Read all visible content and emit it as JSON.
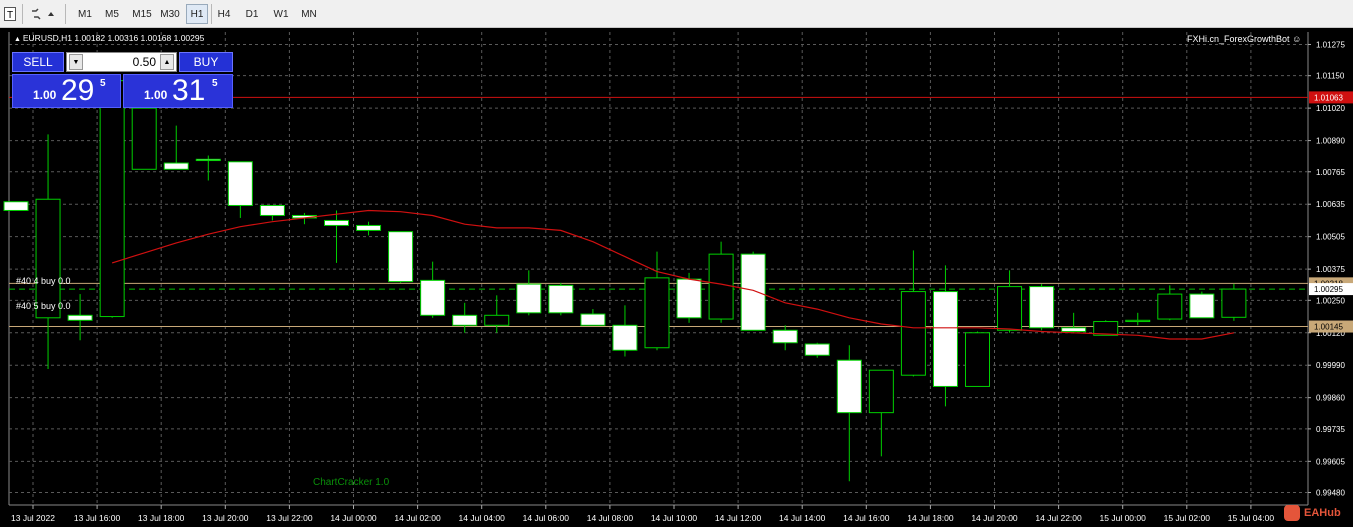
{
  "toolbar": {
    "timeframes": [
      "M1",
      "M5",
      "M15",
      "M30",
      "H1",
      "H4",
      "D1",
      "W1",
      "MN"
    ],
    "active_timeframe": "H1",
    "icons": [
      "text-tool-icon",
      "shapes-tool-icon"
    ]
  },
  "chart": {
    "symbol_header": "EURUSD,H1  1.00182 1.00316 1.00168 1.00295",
    "ea_label": "FXHi.cn_ForexGrowthBot",
    "watermark": "ChartCracker 1.0",
    "order_labels": [
      "#40     4 buy 0.0",
      "#40     5 buy 0.0"
    ],
    "price_axis": [
      "1.01275",
      "1.01150",
      "1.01020",
      "1.00890",
      "1.00765",
      "1.00635",
      "1.00505",
      "1.00375",
      "1.00250",
      "1.00120",
      "0.99990",
      "0.99860",
      "0.99735",
      "0.99605",
      "0.99480"
    ],
    "price_tags": {
      "red_line": "1.01063",
      "order_upper": "1.00318",
      "current": "1.00295",
      "order_lower": "1.00145"
    },
    "time_axis": [
      "13 Jul 2022",
      "13 Jul 16:00",
      "13 Jul 18:00",
      "13 Jul 20:00",
      "13 Jul 22:00",
      "14 Jul 00:00",
      "14 Jul 02:00",
      "14 Jul 04:00",
      "14 Jul 06:00",
      "14 Jul 08:00",
      "14 Jul 10:00",
      "14 Jul 12:00",
      "14 Jul 14:00",
      "14 Jul 16:00",
      "14 Jul 18:00",
      "14 Jul 20:00",
      "14 Jul 22:00",
      "15 Jul 00:00",
      "15 Jul 02:00",
      "15 Jul 04:00"
    ],
    "colors": {
      "bull": "#000000",
      "bear": "#ffffff",
      "outline": "#00d000",
      "ma": "#d01010",
      "grid": "#5a5a5a",
      "order_line": "#c8a878"
    }
  },
  "trade_panel": {
    "sell_label": "SELL",
    "buy_label": "BUY",
    "lot": "0.50",
    "sell_price_small": "1.00",
    "sell_price_big": "29",
    "sell_price_sup": "5",
    "buy_price_small": "1.00",
    "buy_price_big": "31",
    "buy_price_sup": "5"
  },
  "branding": "EAHub",
  "chart_data": {
    "type": "candlestick",
    "candles": [
      {
        "o": 1.00645,
        "h": 1.00645,
        "l": 1.0061,
        "c": 1.0061
      },
      {
        "o": 1.0018,
        "h": 1.00915,
        "l": 0.99975,
        "c": 1.00655
      },
      {
        "o": 1.0019,
        "h": 1.00275,
        "l": 1.0009,
        "c": 1.0017
      },
      {
        "o": 1.00185,
        "h": 1.01135,
        "l": 1.0018,
        "c": 1.0113
      },
      {
        "o": 1.00775,
        "h": 1.01115,
        "l": 1.00775,
        "c": 1.0102
      },
      {
        "o": 1.008,
        "h": 1.0095,
        "l": 1.008,
        "c": 1.00775
      },
      {
        "o": 1.00815,
        "h": 1.0083,
        "l": 1.0073,
        "c": 1.0081
      },
      {
        "o": 1.00805,
        "h": 1.00805,
        "l": 1.0058,
        "c": 1.0063
      },
      {
        "o": 1.0063,
        "h": 1.0063,
        "l": 1.0057,
        "c": 1.0059
      },
      {
        "o": 1.0059,
        "h": 1.006,
        "l": 1.00555,
        "c": 1.0058
      },
      {
        "o": 1.0057,
        "h": 1.0061,
        "l": 1.004,
        "c": 1.0055
      },
      {
        "o": 1.0055,
        "h": 1.00565,
        "l": 1.0051,
        "c": 1.0053
      },
      {
        "o": 1.00525,
        "h": 1.00525,
        "l": 1.0032,
        "c": 1.00325
      },
      {
        "o": 1.0033,
        "h": 1.00405,
        "l": 1.0018,
        "c": 1.0019
      },
      {
        "o": 1.0019,
        "h": 1.0024,
        "l": 1.0012,
        "c": 1.0015
      },
      {
        "o": 1.0015,
        "h": 1.0027,
        "l": 1.0012,
        "c": 1.0019
      },
      {
        "o": 1.00315,
        "h": 1.0037,
        "l": 1.0019,
        "c": 1.002
      },
      {
        "o": 1.0031,
        "h": 1.0032,
        "l": 1.0019,
        "c": 1.002
      },
      {
        "o": 1.00195,
        "h": 1.00215,
        "l": 1.0015,
        "c": 1.0015
      },
      {
        "o": 1.0015,
        "h": 1.0023,
        "l": 1.00025,
        "c": 1.0005
      },
      {
        "o": 1.0006,
        "h": 1.00445,
        "l": 1.0005,
        "c": 1.0034
      },
      {
        "o": 1.00335,
        "h": 1.0036,
        "l": 1.0016,
        "c": 1.0018
      },
      {
        "o": 1.00175,
        "h": 1.00485,
        "l": 1.0016,
        "c": 1.00435
      },
      {
        "o": 1.00435,
        "h": 1.00445,
        "l": 1.0013,
        "c": 1.0013
      },
      {
        "o": 1.0013,
        "h": 1.0015,
        "l": 1.0005,
        "c": 1.0008
      },
      {
        "o": 1.00075,
        "h": 1.0008,
        "l": 1.0002,
        "c": 1.0003
      },
      {
        "o": 1.0001,
        "h": 1.0007,
        "l": 0.99525,
        "c": 0.998
      },
      {
        "o": 0.998,
        "h": 0.9996,
        "l": 0.99625,
        "c": 0.9997
      },
      {
        "o": 0.9995,
        "h": 1.0045,
        "l": 0.99945,
        "c": 1.00285
      },
      {
        "o": 1.00285,
        "h": 1.0039,
        "l": 0.99825,
        "c": 0.99905
      },
      {
        "o": 0.99905,
        "h": 1.00125,
        "l": 0.99905,
        "c": 1.0012
      },
      {
        "o": 1.0013,
        "h": 1.0037,
        "l": 1.0012,
        "c": 1.00305
      },
      {
        "o": 1.00305,
        "h": 1.00315,
        "l": 1.0013,
        "c": 1.0014
      },
      {
        "o": 1.0014,
        "h": 1.002,
        "l": 1.0012,
        "c": 1.00125
      },
      {
        "o": 1.0011,
        "h": 1.0017,
        "l": 1.0011,
        "c": 1.00165
      },
      {
        "o": 1.00165,
        "h": 1.002,
        "l": 1.0015,
        "c": 1.0017
      },
      {
        "o": 1.00175,
        "h": 1.0031,
        "l": 1.0017,
        "c": 1.00275
      },
      {
        "o": 1.00275,
        "h": 1.00285,
        "l": 1.0018,
        "c": 1.0018
      },
      {
        "o": 1.00182,
        "h": 1.00316,
        "l": 1.00168,
        "c": 1.00295
      }
    ],
    "ma": [
      null,
      null,
      null,
      1.004,
      1.0044,
      1.0048,
      1.00515,
      1.00545,
      1.00565,
      1.0058,
      1.00595,
      1.0061,
      1.00605,
      1.0059,
      1.00555,
      1.0054,
      1.0054,
      1.0053,
      1.00485,
      1.00425,
      1.00365,
      1.00335,
      1.00315,
      1.0029,
      1.0024,
      1.00215,
      1.0018,
      1.00155,
      1.0014,
      1.0014,
      1.0014,
      1.00135,
      1.00125,
      1.0012,
      1.00115,
      1.0011,
      1.00095,
      1.00095,
      1.0012
    ],
    "levels": {
      "red_line": 1.01063,
      "order_upper": 1.00318,
      "order_lower": 1.00145,
      "current": 1.00295
    },
    "ylim": [
      0.9943,
      1.01325
    ]
  }
}
